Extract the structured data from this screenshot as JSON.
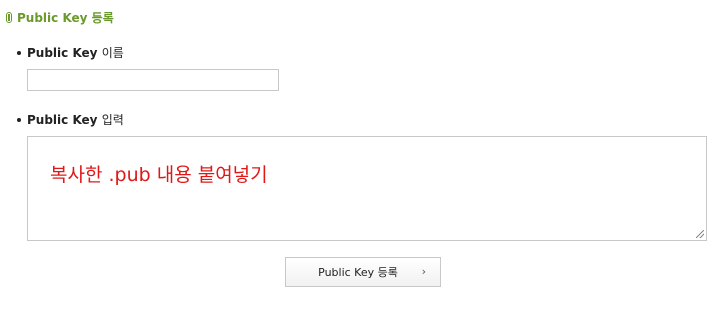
{
  "section": {
    "title": "Public Key 등록"
  },
  "fields": {
    "name": {
      "label_main": "Public Key",
      "label_suffix": "이름",
      "value": ""
    },
    "key": {
      "label_main": "Public Key",
      "label_suffix": "입력",
      "overlay_text": "복사한 .pub 내용 붙여넣기"
    }
  },
  "actions": {
    "submit_label": "Public Key 등록",
    "submit_chevron": "›"
  },
  "colors": {
    "section_title": "#6a9a2c",
    "overlay_text": "#e01818"
  }
}
